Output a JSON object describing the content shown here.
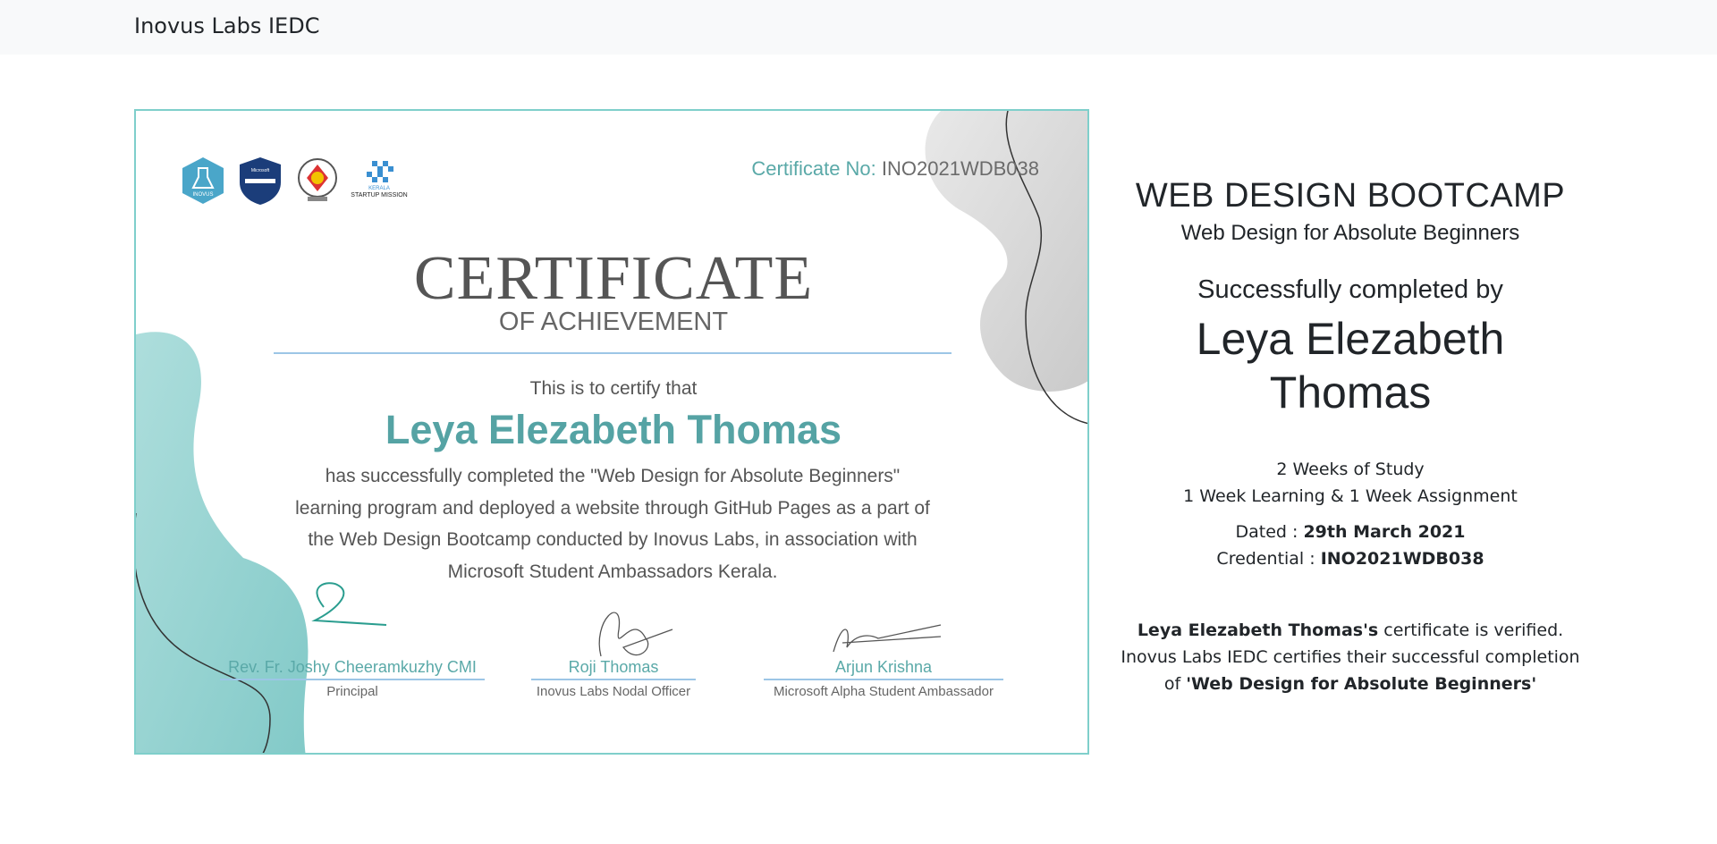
{
  "navbar": {
    "brand": "Inovus Labs IEDC"
  },
  "certificate": {
    "number_label": "Certificate No:",
    "number": "INO2021WDB038",
    "title": "CERTIFICATE",
    "subtitle": "OF ACHIEVEMENT",
    "intro": "This is to certify that",
    "recipient": "Leya Elezabeth Thomas",
    "body_lines": [
      "has successfully completed the \"Web Design for Absolute Beginners\"",
      "learning program and deployed a website through GitHub Pages as a part of",
      "the Web Design Bootcamp conducted by Inovus Labs, in association with",
      "Microsoft Student Ambassadors Kerala."
    ],
    "logos": [
      {
        "name": "inovus-logo",
        "text": "INOVUS"
      },
      {
        "name": "microsoft-learn-student-ambassadors-logo",
        "text": "Microsoft Learn"
      },
      {
        "name": "college-emblem-logo",
        "text": ""
      },
      {
        "name": "kerala-startup-mission-logo",
        "text": "KERALA\nSTARTUP MISSION"
      }
    ],
    "signatories": [
      {
        "name": "Rev. Fr. Joshy Cheeramkuzhy CMI",
        "role": "Principal"
      },
      {
        "name": "Roji Thomas",
        "role": "Inovus Labs Nodal Officer"
      },
      {
        "name": "Arjun Krishna",
        "role": "Microsoft Alpha Student Ambassador"
      }
    ],
    "colors": {
      "accent": "#5aa9a8",
      "border": "#7fcfcb",
      "line": "#9cc6e6"
    }
  },
  "info": {
    "course_title": "WEB DESIGN BOOTCAMP",
    "course_subtitle": "Web Design for Absolute Beginners",
    "completed_label": "Successfully completed by",
    "recipient": "Leya Elezabeth Thomas",
    "study_duration": "2 Weeks of Study",
    "study_breakdown": "1 Week Learning & 1 Week Assignment",
    "dated_label": "Dated : ",
    "dated_value": "29th March 2021",
    "credential_label": "Credential : ",
    "credential_value": "INO2021WDB038",
    "verify_name": "Leya Elezabeth Thomas's",
    "verify_text_1": " certificate is verified.",
    "verify_text_2": "Inovus Labs IEDC certifies their successful completion of ",
    "verify_course": "'Web Design for Absolute Beginners'"
  }
}
